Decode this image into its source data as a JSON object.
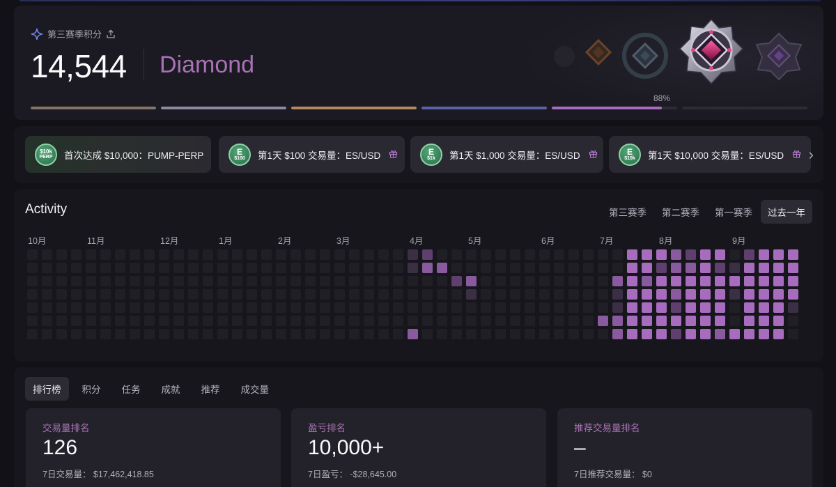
{
  "season": {
    "label": "第三赛季积分",
    "points": "14,544",
    "tier": "Diamond",
    "progress_label": "88%",
    "progress_segments": [
      {
        "fill": 1.0,
        "color": "#857566"
      },
      {
        "fill": 1.0,
        "color": "#8c8aa2"
      },
      {
        "fill": 1.0,
        "color": "#b38a5c"
      },
      {
        "fill": 1.0,
        "color": "#5a63a6"
      },
      {
        "fill": 0.88,
        "color": "#a86cbf"
      },
      {
        "fill": 0.0,
        "color": "#a86cbf"
      }
    ]
  },
  "achievements": [
    {
      "coin": "$10k",
      "coin_sub": "PERP",
      "text": "首次达成 $10,000：PUMP-PERP",
      "gift": false
    },
    {
      "coin": "E",
      "coin_sub": "$100",
      "text": "第1天 $100 交易量：ES/USD",
      "gift": true
    },
    {
      "coin": "E",
      "coin_sub": "$1k",
      "text": "第1天 $1,000 交易量：ES/USD",
      "gift": true
    },
    {
      "coin": "E",
      "coin_sub": "$10k",
      "text": "第1天 $10,000 交易量：ES/USD",
      "gift": true
    }
  ],
  "activity": {
    "title": "Activity",
    "tabs": [
      "第三赛季",
      "第二赛季",
      "第一赛季",
      "过去一年"
    ],
    "active_tab": 3,
    "months": [
      "10月",
      "11月",
      "12月",
      "1月",
      "2月",
      "3月",
      "4月",
      "5月",
      "6月",
      "7月",
      "8月",
      "9月"
    ],
    "weeks": 53,
    "days": 7,
    "active_cells": [
      [
        26,
        0,
        1
      ],
      [
        27,
        0,
        2
      ],
      [
        26,
        1,
        1
      ],
      [
        27,
        1,
        3
      ],
      [
        28,
        1,
        3
      ],
      [
        29,
        2,
        2
      ],
      [
        30,
        2,
        3
      ],
      [
        30,
        3,
        1
      ],
      [
        26,
        6,
        3
      ],
      [
        40,
        4,
        1
      ],
      [
        39,
        5,
        3
      ],
      [
        40,
        5,
        3
      ],
      [
        40,
        6,
        3
      ],
      [
        41,
        0,
        4
      ],
      [
        41,
        1,
        4
      ],
      [
        41,
        2,
        4
      ],
      [
        41,
        3,
        4
      ],
      [
        41,
        4,
        4
      ],
      [
        41,
        5,
        4
      ],
      [
        41,
        6,
        4
      ],
      [
        40,
        2,
        3
      ],
      [
        40,
        3,
        1
      ],
      [
        42,
        0,
        4
      ],
      [
        42,
        1,
        4
      ],
      [
        42,
        2,
        3
      ],
      [
        42,
        3,
        4
      ],
      [
        42,
        4,
        4
      ],
      [
        42,
        5,
        4
      ],
      [
        42,
        6,
        4
      ],
      [
        43,
        0,
        4
      ],
      [
        43,
        1,
        2
      ],
      [
        43,
        2,
        4
      ],
      [
        43,
        3,
        4
      ],
      [
        43,
        4,
        4
      ],
      [
        43,
        5,
        4
      ],
      [
        43,
        6,
        4
      ],
      [
        44,
        0,
        3
      ],
      [
        44,
        1,
        3
      ],
      [
        44,
        2,
        4
      ],
      [
        44,
        3,
        3
      ],
      [
        44,
        4,
        2
      ],
      [
        44,
        5,
        4
      ],
      [
        44,
        6,
        2
      ],
      [
        45,
        0,
        2
      ],
      [
        45,
        1,
        3
      ],
      [
        45,
        2,
        4
      ],
      [
        45,
        3,
        4
      ],
      [
        45,
        4,
        4
      ],
      [
        45,
        5,
        4
      ],
      [
        45,
        6,
        4
      ],
      [
        46,
        0,
        4
      ],
      [
        46,
        1,
        4
      ],
      [
        46,
        2,
        4
      ],
      [
        46,
        3,
        4
      ],
      [
        46,
        4,
        4
      ],
      [
        46,
        5,
        4
      ],
      [
        46,
        6,
        4
      ],
      [
        47,
        0,
        4
      ],
      [
        47,
        1,
        2
      ],
      [
        47,
        2,
        4
      ],
      [
        47,
        3,
        4
      ],
      [
        47,
        4,
        4
      ],
      [
        47,
        5,
        4
      ],
      [
        47,
        6,
        3
      ],
      [
        48,
        1,
        1
      ],
      [
        48,
        2,
        4
      ],
      [
        48,
        3,
        1
      ],
      [
        48,
        6,
        4
      ],
      [
        49,
        0,
        2
      ],
      [
        49,
        1,
        4
      ],
      [
        49,
        2,
        4
      ],
      [
        49,
        3,
        4
      ],
      [
        49,
        4,
        4
      ],
      [
        49,
        5,
        4
      ],
      [
        49,
        6,
        4
      ],
      [
        50,
        0,
        4
      ],
      [
        50,
        1,
        4
      ],
      [
        50,
        2,
        4
      ],
      [
        50,
        3,
        4
      ],
      [
        50,
        4,
        4
      ],
      [
        50,
        5,
        4
      ],
      [
        50,
        6,
        4
      ],
      [
        51,
        0,
        4
      ],
      [
        51,
        1,
        4
      ],
      [
        51,
        2,
        4
      ],
      [
        51,
        3,
        4
      ],
      [
        51,
        4,
        4
      ],
      [
        51,
        5,
        4
      ],
      [
        51,
        6,
        4
      ],
      [
        52,
        0,
        4
      ],
      [
        52,
        1,
        4
      ],
      [
        52,
        2,
        4
      ],
      [
        52,
        3,
        4
      ],
      [
        52,
        4,
        1
      ]
    ]
  },
  "board": {
    "tabs": [
      "排行榜",
      "积分",
      "任务",
      "成就",
      "推荐",
      "成交量"
    ],
    "cards": [
      {
        "label": "交易量排名",
        "value": "126",
        "sub": "7日交易量：  $17,462,418.85"
      },
      {
        "label": "盈亏排名",
        "value": "10,000+",
        "sub": "7日盈亏：  -$28,645.00"
      },
      {
        "label": "推荐交易量排名",
        "value": "–",
        "sub": "7日推荐交易量：  $0"
      }
    ]
  }
}
